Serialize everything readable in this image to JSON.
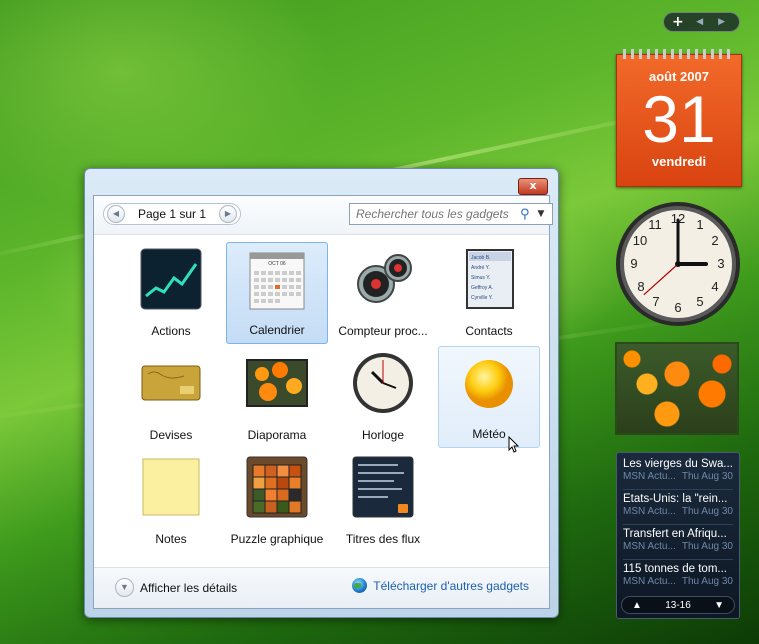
{
  "sidebar": {
    "add_label": "+",
    "calendar": {
      "month": "août 2007",
      "day": "31",
      "weekday": "vendredi"
    },
    "clock": {
      "hour": 3,
      "minute": 0,
      "second": 38
    },
    "feeds": {
      "items": [
        {
          "title": "Les vierges du Swa...",
          "source": "MSN Actu...",
          "date": "Thu Aug 30"
        },
        {
          "title": "Etats-Unis: la \"rein...",
          "source": "MSN Actu...",
          "date": "Thu Aug 30"
        },
        {
          "title": "Transfert en Afriqu...",
          "source": "MSN Actu...",
          "date": "Thu Aug 30"
        },
        {
          "title": "115 tonnes de tom...",
          "source": "MSN Actu...",
          "date": "Thu Aug 30"
        }
      ],
      "range": "13-16"
    }
  },
  "gallery": {
    "pager_label": "Page 1 sur 1",
    "search_placeholder": "Rechercher tous les gadgets",
    "gadgets": [
      {
        "name": "Actions",
        "icon": "stocks-chart-icon"
      },
      {
        "name": "Calendrier",
        "icon": "calendar-icon"
      },
      {
        "name": "Compteur proc...",
        "icon": "cpu-meter-icon"
      },
      {
        "name": "Contacts",
        "icon": "contacts-icon"
      },
      {
        "name": "Devises",
        "icon": "currency-card-icon"
      },
      {
        "name": "Diaporama",
        "icon": "slideshow-icon"
      },
      {
        "name": "Horloge",
        "icon": "clock-icon"
      },
      {
        "name": "Météo",
        "icon": "weather-sun-icon"
      },
      {
        "name": "Notes",
        "icon": "notes-icon"
      },
      {
        "name": "Puzzle graphique",
        "icon": "picture-puzzle-icon"
      },
      {
        "name": "Titres des flux",
        "icon": "feed-headlines-icon"
      }
    ],
    "contacts_preview": [
      "Jacob B.",
      "André Y.",
      "Simus Y.",
      "Geffroy A.",
      "Cyrville Y."
    ],
    "calendar_icon_month": "OCT 06",
    "details_label": "Afficher les détails",
    "download_label": "Télécharger d'autres gadgets",
    "close_label": "x"
  },
  "colors": {
    "calendar_orange": "#e5531c",
    "link_blue": "#1b5fb0",
    "selection": "#c4dcf5"
  }
}
